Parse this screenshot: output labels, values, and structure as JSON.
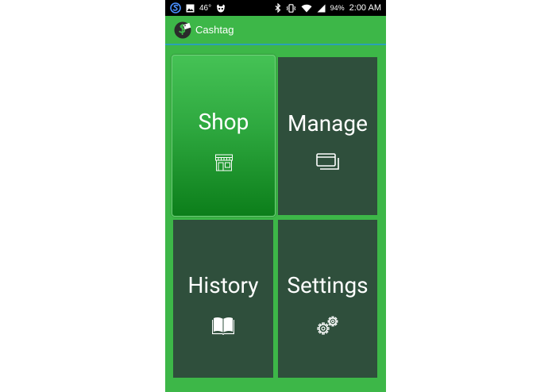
{
  "status_bar": {
    "temperature": "46°",
    "battery": "94%",
    "time": "2:00 AM",
    "left_icons": [
      "sync-icon",
      "image-icon",
      "temperature-text",
      "app-notification-icon"
    ],
    "right_icons": [
      "bluetooth-icon",
      "vibrate-icon",
      "wifi-icon",
      "signal-icon",
      "battery-text",
      "time-text"
    ]
  },
  "app_bar": {
    "title": "Cashtag",
    "logo_icon": "cashtag-logo-icon",
    "underline_color": "#2aa1b6"
  },
  "tiles": [
    {
      "id": "shop",
      "label": "Shop",
      "icon": "store-icon",
      "selected": true
    },
    {
      "id": "manage",
      "label": "Manage",
      "icon": "cards-icon",
      "selected": false
    },
    {
      "id": "history",
      "label": "History",
      "icon": "book-icon",
      "selected": false
    },
    {
      "id": "settings",
      "label": "Settings",
      "icon": "gears-icon",
      "selected": false
    }
  ],
  "colors": {
    "background": "#3db748",
    "tile": "#2f4f3c",
    "tile_selected_top": "#45c255",
    "tile_selected_bottom": "#0c7e1a",
    "status_bar": "#000000"
  }
}
